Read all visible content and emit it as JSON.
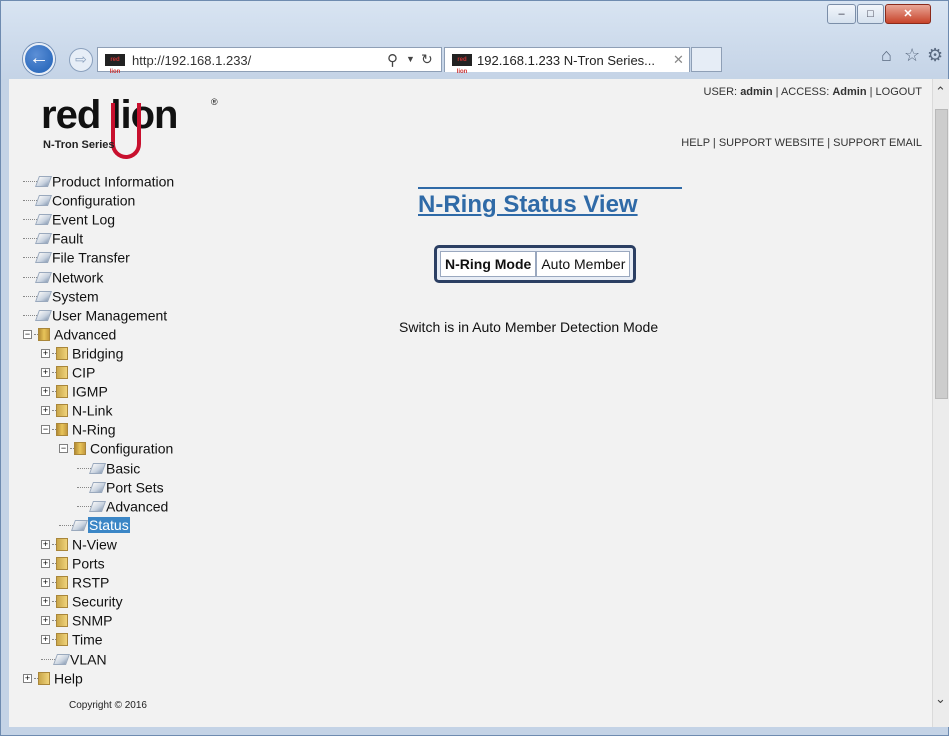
{
  "browser": {
    "url": "http://192.168.1.233/",
    "tab_title": "192.168.1.233 N-Tron Series...",
    "favicon_text": "red lion",
    "window_controls": {
      "minimize": "–",
      "maximize": "□",
      "close": "✕"
    }
  },
  "header": {
    "logo_text": "red lion",
    "logo_sub": "N-Tron Series",
    "user_label": "USER:",
    "user": "admin",
    "access_label": "ACCESS:",
    "access": "Admin",
    "logout": "LOGOUT",
    "help": "HELP",
    "support_website": "SUPPORT WEBSITE",
    "support_email": "SUPPORT EMAIL",
    "sep": "|"
  },
  "tree": [
    {
      "label": "Product Information",
      "icon": "page"
    },
    {
      "label": "Configuration",
      "icon": "page"
    },
    {
      "label": "Event Log",
      "icon": "page"
    },
    {
      "label": "Fault",
      "icon": "page"
    },
    {
      "label": "File Transfer",
      "icon": "page"
    },
    {
      "label": "Network",
      "icon": "page"
    },
    {
      "label": "System",
      "icon": "page"
    },
    {
      "label": "User Management",
      "icon": "page"
    },
    {
      "label": "Advanced",
      "icon": "folder-open",
      "expander": "−"
    },
    {
      "label": "Bridging",
      "icon": "folder",
      "expander": "+"
    },
    {
      "label": "CIP",
      "icon": "folder",
      "expander": "+"
    },
    {
      "label": "IGMP",
      "icon": "folder",
      "expander": "+"
    },
    {
      "label": "N-Link",
      "icon": "folder",
      "expander": "+"
    },
    {
      "label": "N-Ring",
      "icon": "folder-open",
      "expander": "−"
    },
    {
      "label": "Configuration",
      "icon": "folder-open",
      "expander": "−"
    },
    {
      "label": "Basic",
      "icon": "page"
    },
    {
      "label": "Port Sets",
      "icon": "page"
    },
    {
      "label": "Advanced",
      "icon": "page"
    },
    {
      "label": "Status",
      "icon": "page",
      "selected": true
    },
    {
      "label": "N-View",
      "icon": "folder",
      "expander": "+"
    },
    {
      "label": "Ports",
      "icon": "folder",
      "expander": "+"
    },
    {
      "label": "RSTP",
      "icon": "folder",
      "expander": "+"
    },
    {
      "label": "Security",
      "icon": "folder",
      "expander": "+"
    },
    {
      "label": "SNMP",
      "icon": "folder",
      "expander": "+"
    },
    {
      "label": "Time",
      "icon": "folder",
      "expander": "+"
    },
    {
      "label": "VLAN",
      "icon": "page"
    },
    {
      "label": "Help",
      "icon": "folder",
      "expander": "+"
    }
  ],
  "main": {
    "title": "N-Ring Status View",
    "mode_label": "N-Ring Mode",
    "mode_value": "Auto Member",
    "status_message": "Switch is in Auto Member Detection Mode"
  },
  "footer": {
    "copyright": "Copyright © 2016"
  },
  "colors": {
    "title": "#2f6aa7",
    "selection": "#3b86c6",
    "brand_red": "#c8102e"
  }
}
